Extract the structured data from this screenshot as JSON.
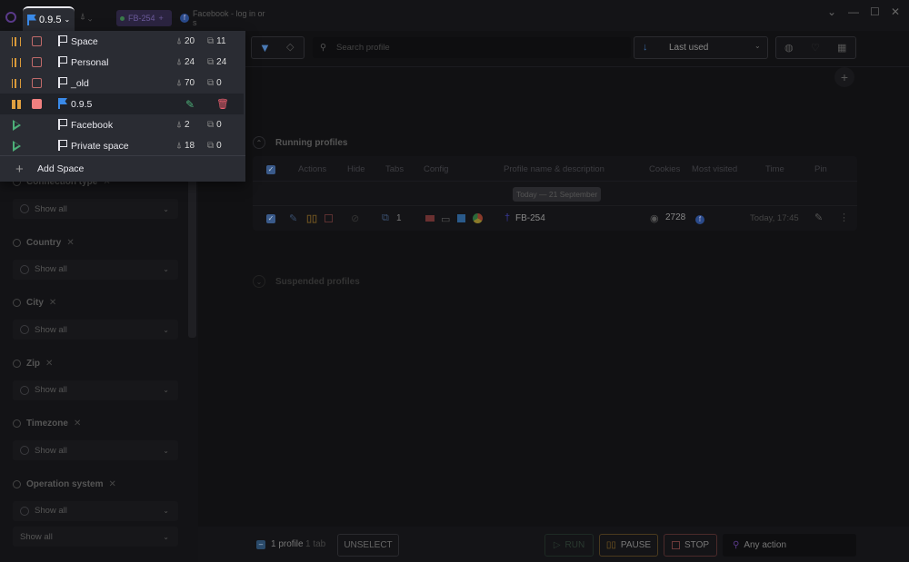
{
  "topbar": {
    "current_space": "0.9.5",
    "profile_tab": "FB-254",
    "facebook_tab": "Facebook - log in or s",
    "window_controls": [
      "chevron-down",
      "minimize",
      "maximize",
      "close"
    ]
  },
  "spaces": [
    {
      "name": "Space",
      "profiles": "20",
      "tabs": "11",
      "state": "running"
    },
    {
      "name": "Personal",
      "profiles": "24",
      "tabs": "24",
      "state": "running"
    },
    {
      "name": "_old",
      "profiles": "70",
      "tabs": "0",
      "state": "running"
    },
    {
      "name": "0.9.5",
      "profiles": "",
      "tabs": "",
      "state": "active"
    },
    {
      "name": "Facebook",
      "profiles": "2",
      "tabs": "0",
      "state": "stopped"
    },
    {
      "name": "Private space",
      "profiles": "18",
      "tabs": "0",
      "state": "stopped"
    }
  ],
  "add_space": "Add Space",
  "filters": [
    {
      "label": "Connection type",
      "value": "Show all"
    },
    {
      "label": "Country",
      "value": "Show all"
    },
    {
      "label": "City",
      "value": "Show all"
    },
    {
      "label": "Zip",
      "value": "Show all"
    },
    {
      "label": "Timezone",
      "value": "Show all"
    },
    {
      "label": "Operation system",
      "value": "Show all"
    }
  ],
  "extra_select": "Show all",
  "toolbar": {
    "search_placeholder": "Search profile",
    "sort": "Last used"
  },
  "running": {
    "title": "Running profiles",
    "columns": [
      "Actions",
      "Hide",
      "Tabs",
      "Config",
      "Profile name & description",
      "Cookies",
      "Most visited",
      "Time",
      "Pin"
    ],
    "date_group": "Today — 21 September",
    "rows": [
      {
        "tabs": "1",
        "name": "FB-254",
        "cookies": "2728",
        "time": "Today, 17:45"
      }
    ]
  },
  "suspended": {
    "title": "Suspended profiles"
  },
  "bottom": {
    "count": "1 profile",
    "tabs": "1 tab",
    "unselect": "UNSELECT",
    "run": "RUN",
    "pause": "PAUSE",
    "stop": "STOP",
    "any_action": "Any action"
  },
  "colors": {
    "pause": "#e0a040",
    "stop": "#f08080",
    "run": "#4caf78",
    "accent": "#3a7bd5",
    "edit": "#4caf78",
    "delete": "#f06070"
  }
}
